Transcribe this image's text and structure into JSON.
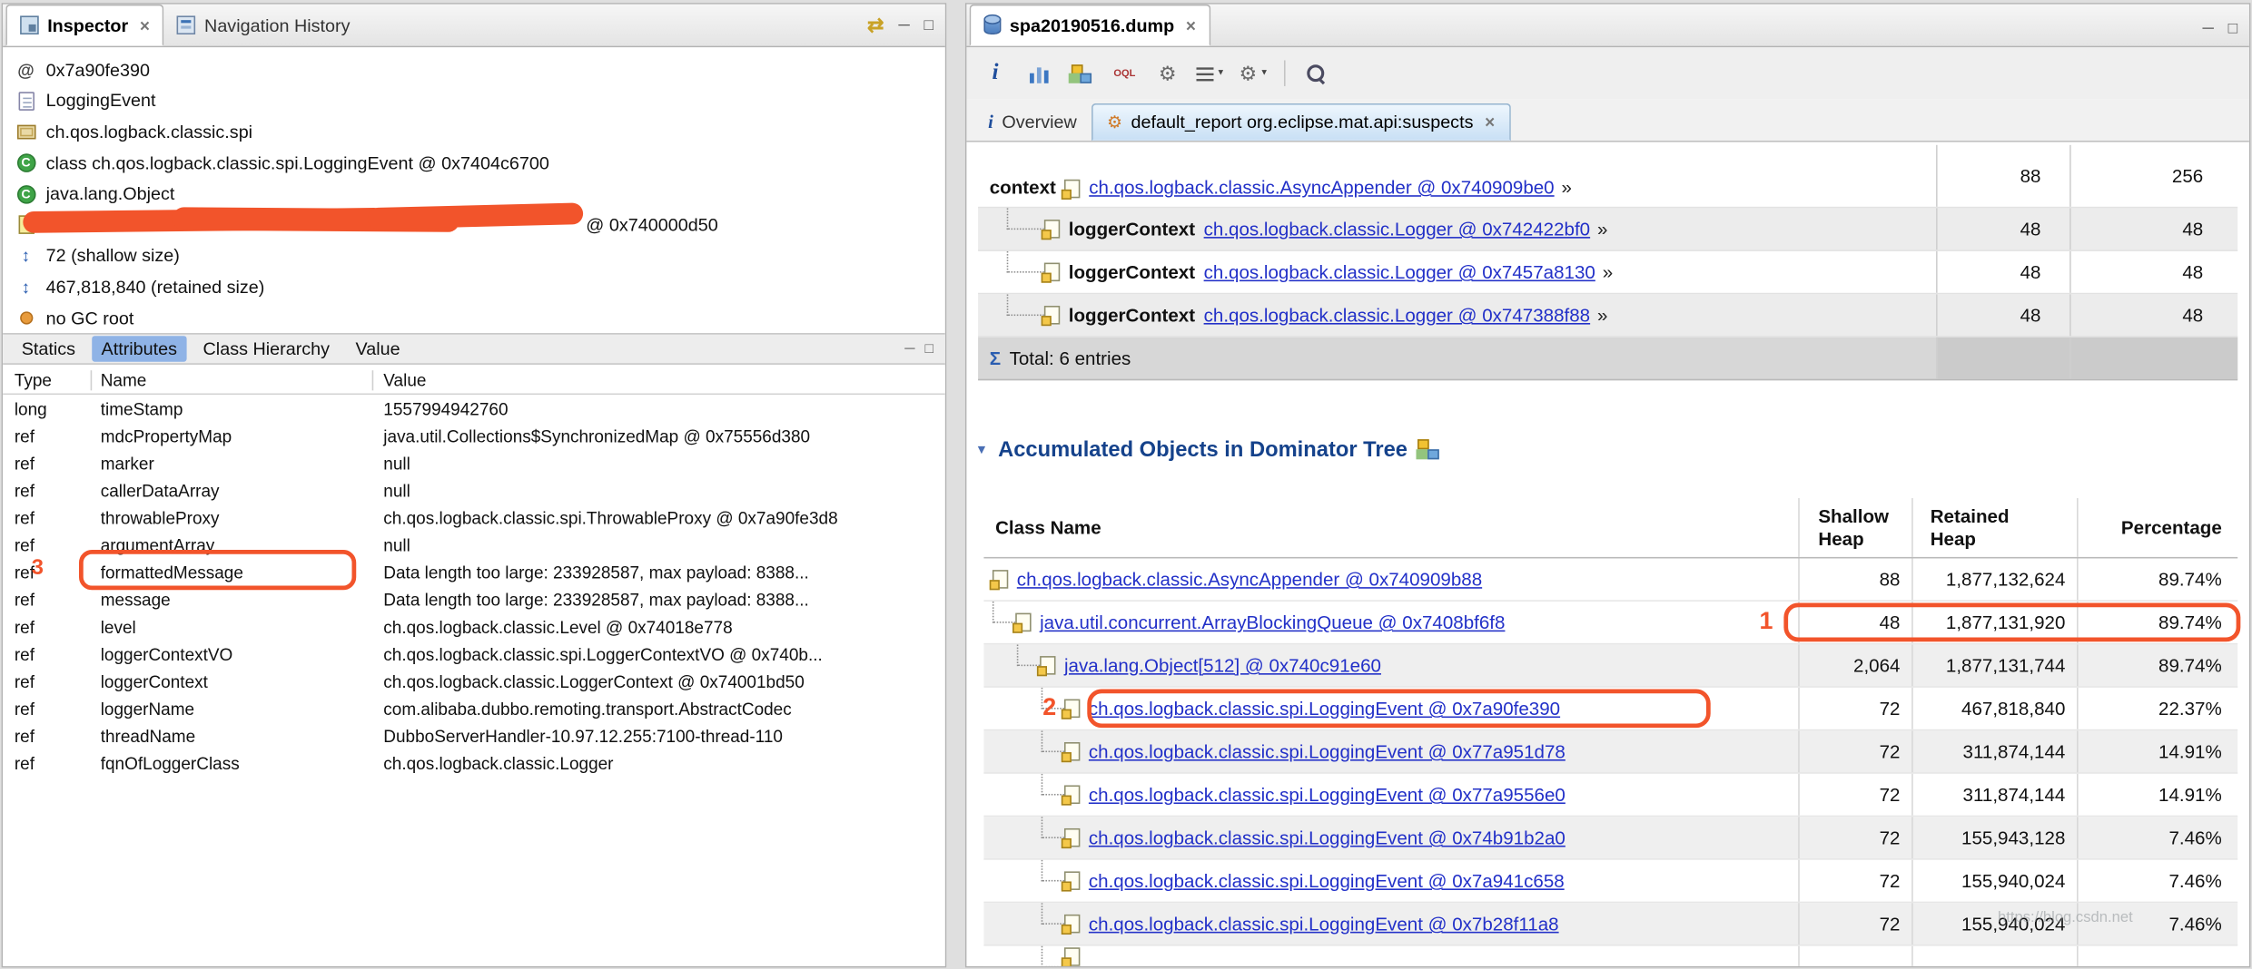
{
  "glyphs": {
    "close": "×",
    "minimize": "─",
    "maximize": "□",
    "sync": "⇄",
    "dropdown": "▼",
    "sigma": "Σ",
    "twistie": "▼"
  },
  "inspector": {
    "tab_label": "Inspector",
    "nav_tab_label": "Navigation History",
    "object_lines": [
      {
        "icon": "at-icon",
        "glyph": "@",
        "text": "0x7a90fe390"
      },
      {
        "icon": "document-icon",
        "text": "LoggingEvent"
      },
      {
        "icon": "package-icon",
        "text": "ch.qos.logback.classic.spi"
      },
      {
        "icon": "class-icon",
        "glyph": "C",
        "text": "class ch.qos.logback.classic.spi.LoggingEvent @ 0x7404c6700"
      },
      {
        "icon": "superclass-icon",
        "glyph": "C",
        "text": "java.lang.Object"
      },
      {
        "icon": "object-icon",
        "text": "@ 0x740000d50",
        "redacted": true
      },
      {
        "icon": "shallow-size-icon",
        "glyph": "↕",
        "text": "72 (shallow size)"
      },
      {
        "icon": "retained-size-icon",
        "glyph": "↕",
        "text": "467,818,840 (retained size)"
      },
      {
        "icon": "gc-root-icon",
        "text": "no GC root"
      }
    ],
    "detail_tabs": [
      {
        "label": "Statics",
        "active": false
      },
      {
        "label": "Attributes",
        "active": true
      },
      {
        "label": "Class Hierarchy",
        "active": false
      },
      {
        "label": "Value",
        "active": false
      }
    ],
    "attributes_table": {
      "headers": [
        "Type",
        "Name",
        "Value"
      ],
      "rows": [
        {
          "type": "long",
          "name": "timeStamp",
          "value": "1557994942760"
        },
        {
          "type": "ref",
          "name": "mdcPropertyMap",
          "value": "java.util.Collections$SynchronizedMap @ 0x75556d380"
        },
        {
          "type": "ref",
          "name": "marker",
          "value": "null"
        },
        {
          "type": "ref",
          "name": "callerDataArray",
          "value": "null"
        },
        {
          "type": "ref",
          "name": "throwableProxy",
          "value": "ch.qos.logback.classic.spi.ThrowableProxy @ 0x7a90fe3d8"
        },
        {
          "type": "ref",
          "name": "argumentArray",
          "value": "null"
        },
        {
          "type": "ref",
          "name": "formattedMessage",
          "value": "Data length too large: 233928587, max payload: 8388..."
        },
        {
          "type": "ref",
          "name": "message",
          "value": "Data length too large: 233928587, max payload: 8388..."
        },
        {
          "type": "ref",
          "name": "level",
          "value": "ch.qos.logback.classic.Level @ 0x74018e778"
        },
        {
          "type": "ref",
          "name": "loggerContextVO",
          "value": "ch.qos.logback.classic.spi.LoggerContextVO @ 0x740b..."
        },
        {
          "type": "ref",
          "name": "loggerContext",
          "value": "ch.qos.logback.classic.LoggerContext @ 0x74001bd50"
        },
        {
          "type": "ref",
          "name": "loggerName",
          "value": "com.alibaba.dubbo.remoting.transport.AbstractCodec"
        },
        {
          "type": "ref",
          "name": "threadName",
          "value": "DubboServerHandler-10.97.12.255:7100-thread-110"
        },
        {
          "type": "ref",
          "name": "fqnOfLoggerClass",
          "value": "ch.qos.logback.classic.Logger"
        }
      ]
    }
  },
  "editor": {
    "dump_tab_label": "spa20190516.dump",
    "toolbar": [
      {
        "name": "info-icon",
        "style": "info",
        "glyph": "i"
      },
      {
        "name": "histogram-icon",
        "style": "hist"
      },
      {
        "name": "dominator-tree-icon",
        "style": "tree"
      },
      {
        "name": "oql-icon",
        "style": "oql",
        "glyph": "OQL"
      },
      {
        "name": "thread-overview-icon",
        "style": "gear",
        "glyph": "⚙"
      },
      {
        "name": "queries-menu-icon",
        "style": "list",
        "dropdown": true
      },
      {
        "name": "inspections-menu-icon",
        "style": "gear2",
        "glyph": "⚙",
        "dropdown": true
      },
      {
        "name": "separator",
        "style": "sep"
      },
      {
        "name": "search-icon",
        "style": "search"
      }
    ],
    "view_tabs": {
      "overview_label": "Overview",
      "report_label": "default_report org.eclipse.mat.api:suspects"
    },
    "context_table": {
      "rows": [
        {
          "label": "context",
          "link": "ch.qos.logback.classic.AsyncAppender @ 0x740909be0",
          "arrow": "»",
          "shallow": "88",
          "retained": "256",
          "indent": 0,
          "tall": true
        },
        {
          "label": "loggerContext",
          "link": "ch.qos.logback.classic.Logger @ 0x742422bf0",
          "arrow": "»",
          "shallow": "48",
          "retained": "48",
          "indent": 1
        },
        {
          "label": "loggerContext",
          "link": "ch.qos.logback.classic.Logger @ 0x7457a8130",
          "arrow": "»",
          "shallow": "48",
          "retained": "48",
          "indent": 1
        },
        {
          "label": "loggerContext",
          "link": "ch.qos.logback.classic.Logger @ 0x747388f88",
          "arrow": "»",
          "shallow": "48",
          "retained": "48",
          "indent": 1
        }
      ],
      "total_label": "Total: 6 entries"
    },
    "section_title": "Accumulated Objects in Dominator Tree",
    "dominator_table": {
      "headers": {
        "class": "Class Name",
        "shallow": "Shallow Heap",
        "retained": "Retained Heap",
        "pct": "Percentage"
      },
      "rows": [
        {
          "link": "ch.qos.logback.classic.AsyncAppender @ 0x740909b88",
          "indent": 0,
          "shallow": "88",
          "retained": "1,877,132,624",
          "pct": "89.74%"
        },
        {
          "link": "java.util.concurrent.ArrayBlockingQueue @ 0x7408bf6f8",
          "indent": 1,
          "shallow": "48",
          "retained": "1,877,131,920",
          "pct": "89.74%"
        },
        {
          "link": "java.lang.Object[512] @ 0x740c91e60",
          "indent": 2,
          "shallow": "2,064",
          "retained": "1,877,131,744",
          "pct": "89.74%"
        },
        {
          "link": "ch.qos.logback.classic.spi.LoggingEvent @ 0x7a90fe390",
          "indent": 3,
          "shallow": "72",
          "retained": "467,818,840",
          "pct": "22.37%"
        },
        {
          "link": "ch.qos.logback.classic.spi.LoggingEvent @ 0x77a951d78",
          "indent": 3,
          "shallow": "72",
          "retained": "311,874,144",
          "pct": "14.91%"
        },
        {
          "link": "ch.qos.logback.classic.spi.LoggingEvent @ 0x77a9556e0",
          "indent": 3,
          "shallow": "72",
          "retained": "311,874,144",
          "pct": "14.91%"
        },
        {
          "link": "ch.qos.logback.classic.spi.LoggingEvent @ 0x74b91b2a0",
          "indent": 3,
          "shallow": "72",
          "retained": "155,943,128",
          "pct": "7.46%"
        },
        {
          "link": "ch.qos.logback.classic.spi.LoggingEvent @ 0x7a941c658",
          "indent": 3,
          "shallow": "72",
          "retained": "155,940,024",
          "pct": "7.46%"
        },
        {
          "link": "ch.qos.logback.classic.spi.LoggingEvent @ 0x7b28f11a8",
          "indent": 3,
          "shallow": "72",
          "retained": "155,940,024",
          "pct": "7.46%"
        }
      ]
    },
    "watermark": "https://blog.csdn.net"
  },
  "annotations": {
    "num1": "1",
    "num2": "2",
    "num3": "3"
  }
}
